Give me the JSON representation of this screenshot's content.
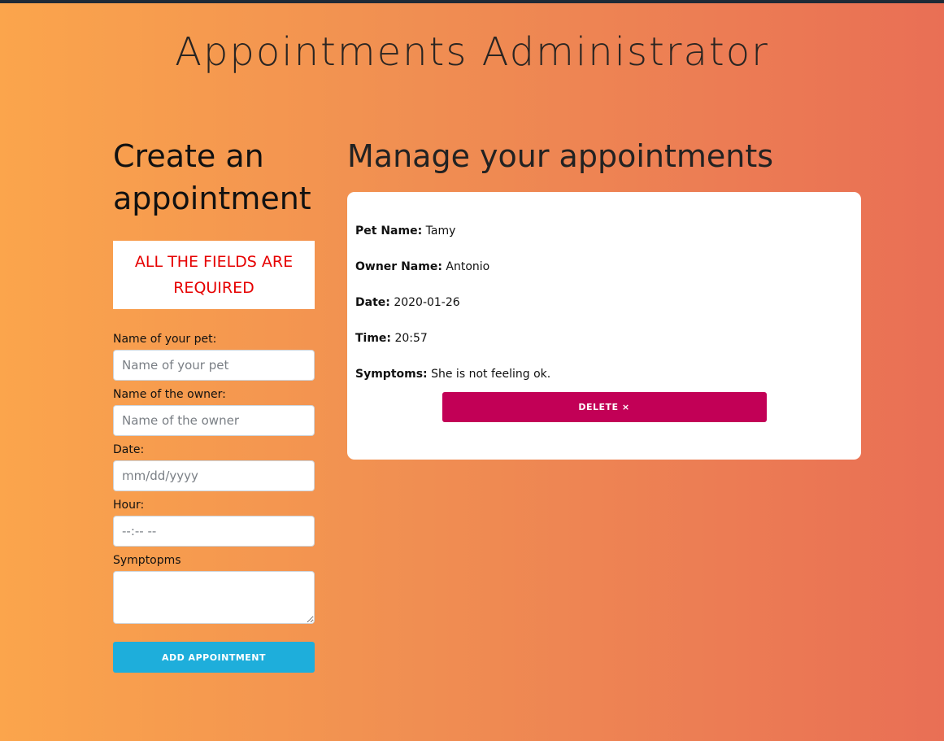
{
  "app": {
    "title": "Appointments Administrator"
  },
  "create": {
    "heading": "Create an appointment",
    "warning": "ALL THE FIELDS ARE REQUIRED",
    "fields": {
      "pet": {
        "label": "Name of your pet:",
        "placeholder": "Name of your pet"
      },
      "owner": {
        "label": "Name of the owner:",
        "placeholder": "Name of the owner"
      },
      "date": {
        "label": "Date:",
        "placeholder": "mm/dd/yyyy"
      },
      "hour": {
        "label": "Hour:",
        "placeholder": "--:-- --"
      },
      "symptoms": {
        "label": "Symptopms",
        "placeholder": ""
      }
    },
    "submit_label": "Add appointment"
  },
  "manage": {
    "heading": "Manage your appointments",
    "appointments": [
      {
        "pet_key": "Pet Name:",
        "pet": "Tamy",
        "owner_key": "Owner Name:",
        "owner": "Antonio",
        "date_key": "Date:",
        "date": "2020-01-26",
        "time_key": "Time:",
        "time": "20:57",
        "symptoms_key": "Symptoms:",
        "symptoms": "She is not feeling ok.",
        "delete_label": "Delete ×"
      }
    ]
  },
  "colors": {
    "gradient_start": "#fba54c",
    "gradient_end": "#e96f55",
    "add_button": "#1eaedb",
    "delete_button": "#c20056",
    "warning_text": "#e60000"
  }
}
